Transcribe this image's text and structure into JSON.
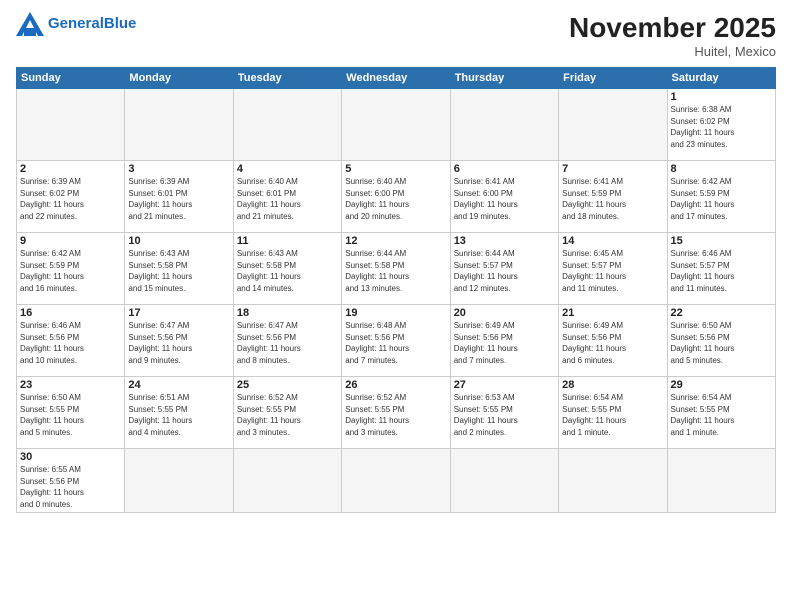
{
  "header": {
    "logo_general": "General",
    "logo_blue": "Blue",
    "month_year": "November 2025",
    "location": "Huitel, Mexico"
  },
  "weekdays": [
    "Sunday",
    "Monday",
    "Tuesday",
    "Wednesday",
    "Thursday",
    "Friday",
    "Saturday"
  ],
  "weeks": [
    [
      {
        "day": "",
        "info": ""
      },
      {
        "day": "",
        "info": ""
      },
      {
        "day": "",
        "info": ""
      },
      {
        "day": "",
        "info": ""
      },
      {
        "day": "",
        "info": ""
      },
      {
        "day": "",
        "info": ""
      },
      {
        "day": "1",
        "info": "Sunrise: 6:38 AM\nSunset: 6:02 PM\nDaylight: 11 hours\nand 23 minutes."
      }
    ],
    [
      {
        "day": "2",
        "info": "Sunrise: 6:39 AM\nSunset: 6:02 PM\nDaylight: 11 hours\nand 22 minutes."
      },
      {
        "day": "3",
        "info": "Sunrise: 6:39 AM\nSunset: 6:01 PM\nDaylight: 11 hours\nand 21 minutes."
      },
      {
        "day": "4",
        "info": "Sunrise: 6:40 AM\nSunset: 6:01 PM\nDaylight: 11 hours\nand 21 minutes."
      },
      {
        "day": "5",
        "info": "Sunrise: 6:40 AM\nSunset: 6:00 PM\nDaylight: 11 hours\nand 20 minutes."
      },
      {
        "day": "6",
        "info": "Sunrise: 6:41 AM\nSunset: 6:00 PM\nDaylight: 11 hours\nand 19 minutes."
      },
      {
        "day": "7",
        "info": "Sunrise: 6:41 AM\nSunset: 5:59 PM\nDaylight: 11 hours\nand 18 minutes."
      },
      {
        "day": "8",
        "info": "Sunrise: 6:42 AM\nSunset: 5:59 PM\nDaylight: 11 hours\nand 17 minutes."
      }
    ],
    [
      {
        "day": "9",
        "info": "Sunrise: 6:42 AM\nSunset: 5:59 PM\nDaylight: 11 hours\nand 16 minutes."
      },
      {
        "day": "10",
        "info": "Sunrise: 6:43 AM\nSunset: 5:58 PM\nDaylight: 11 hours\nand 15 minutes."
      },
      {
        "day": "11",
        "info": "Sunrise: 6:43 AM\nSunset: 5:58 PM\nDaylight: 11 hours\nand 14 minutes."
      },
      {
        "day": "12",
        "info": "Sunrise: 6:44 AM\nSunset: 5:58 PM\nDaylight: 11 hours\nand 13 minutes."
      },
      {
        "day": "13",
        "info": "Sunrise: 6:44 AM\nSunset: 5:57 PM\nDaylight: 11 hours\nand 12 minutes."
      },
      {
        "day": "14",
        "info": "Sunrise: 6:45 AM\nSunset: 5:57 PM\nDaylight: 11 hours\nand 11 minutes."
      },
      {
        "day": "15",
        "info": "Sunrise: 6:46 AM\nSunset: 5:57 PM\nDaylight: 11 hours\nand 11 minutes."
      }
    ],
    [
      {
        "day": "16",
        "info": "Sunrise: 6:46 AM\nSunset: 5:56 PM\nDaylight: 11 hours\nand 10 minutes."
      },
      {
        "day": "17",
        "info": "Sunrise: 6:47 AM\nSunset: 5:56 PM\nDaylight: 11 hours\nand 9 minutes."
      },
      {
        "day": "18",
        "info": "Sunrise: 6:47 AM\nSunset: 5:56 PM\nDaylight: 11 hours\nand 8 minutes."
      },
      {
        "day": "19",
        "info": "Sunrise: 6:48 AM\nSunset: 5:56 PM\nDaylight: 11 hours\nand 7 minutes."
      },
      {
        "day": "20",
        "info": "Sunrise: 6:49 AM\nSunset: 5:56 PM\nDaylight: 11 hours\nand 7 minutes."
      },
      {
        "day": "21",
        "info": "Sunrise: 6:49 AM\nSunset: 5:56 PM\nDaylight: 11 hours\nand 6 minutes."
      },
      {
        "day": "22",
        "info": "Sunrise: 6:50 AM\nSunset: 5:56 PM\nDaylight: 11 hours\nand 5 minutes."
      }
    ],
    [
      {
        "day": "23",
        "info": "Sunrise: 6:50 AM\nSunset: 5:55 PM\nDaylight: 11 hours\nand 5 minutes."
      },
      {
        "day": "24",
        "info": "Sunrise: 6:51 AM\nSunset: 5:55 PM\nDaylight: 11 hours\nand 4 minutes."
      },
      {
        "day": "25",
        "info": "Sunrise: 6:52 AM\nSunset: 5:55 PM\nDaylight: 11 hours\nand 3 minutes."
      },
      {
        "day": "26",
        "info": "Sunrise: 6:52 AM\nSunset: 5:55 PM\nDaylight: 11 hours\nand 3 minutes."
      },
      {
        "day": "27",
        "info": "Sunrise: 6:53 AM\nSunset: 5:55 PM\nDaylight: 11 hours\nand 2 minutes."
      },
      {
        "day": "28",
        "info": "Sunrise: 6:54 AM\nSunset: 5:55 PM\nDaylight: 11 hours\nand 1 minute."
      },
      {
        "day": "29",
        "info": "Sunrise: 6:54 AM\nSunset: 5:55 PM\nDaylight: 11 hours\nand 1 minute."
      }
    ],
    [
      {
        "day": "30",
        "info": "Sunrise: 6:55 AM\nSunset: 5:56 PM\nDaylight: 11 hours\nand 0 minutes."
      },
      {
        "day": "",
        "info": ""
      },
      {
        "day": "",
        "info": ""
      },
      {
        "day": "",
        "info": ""
      },
      {
        "day": "",
        "info": ""
      },
      {
        "day": "",
        "info": ""
      },
      {
        "day": "",
        "info": ""
      }
    ]
  ]
}
